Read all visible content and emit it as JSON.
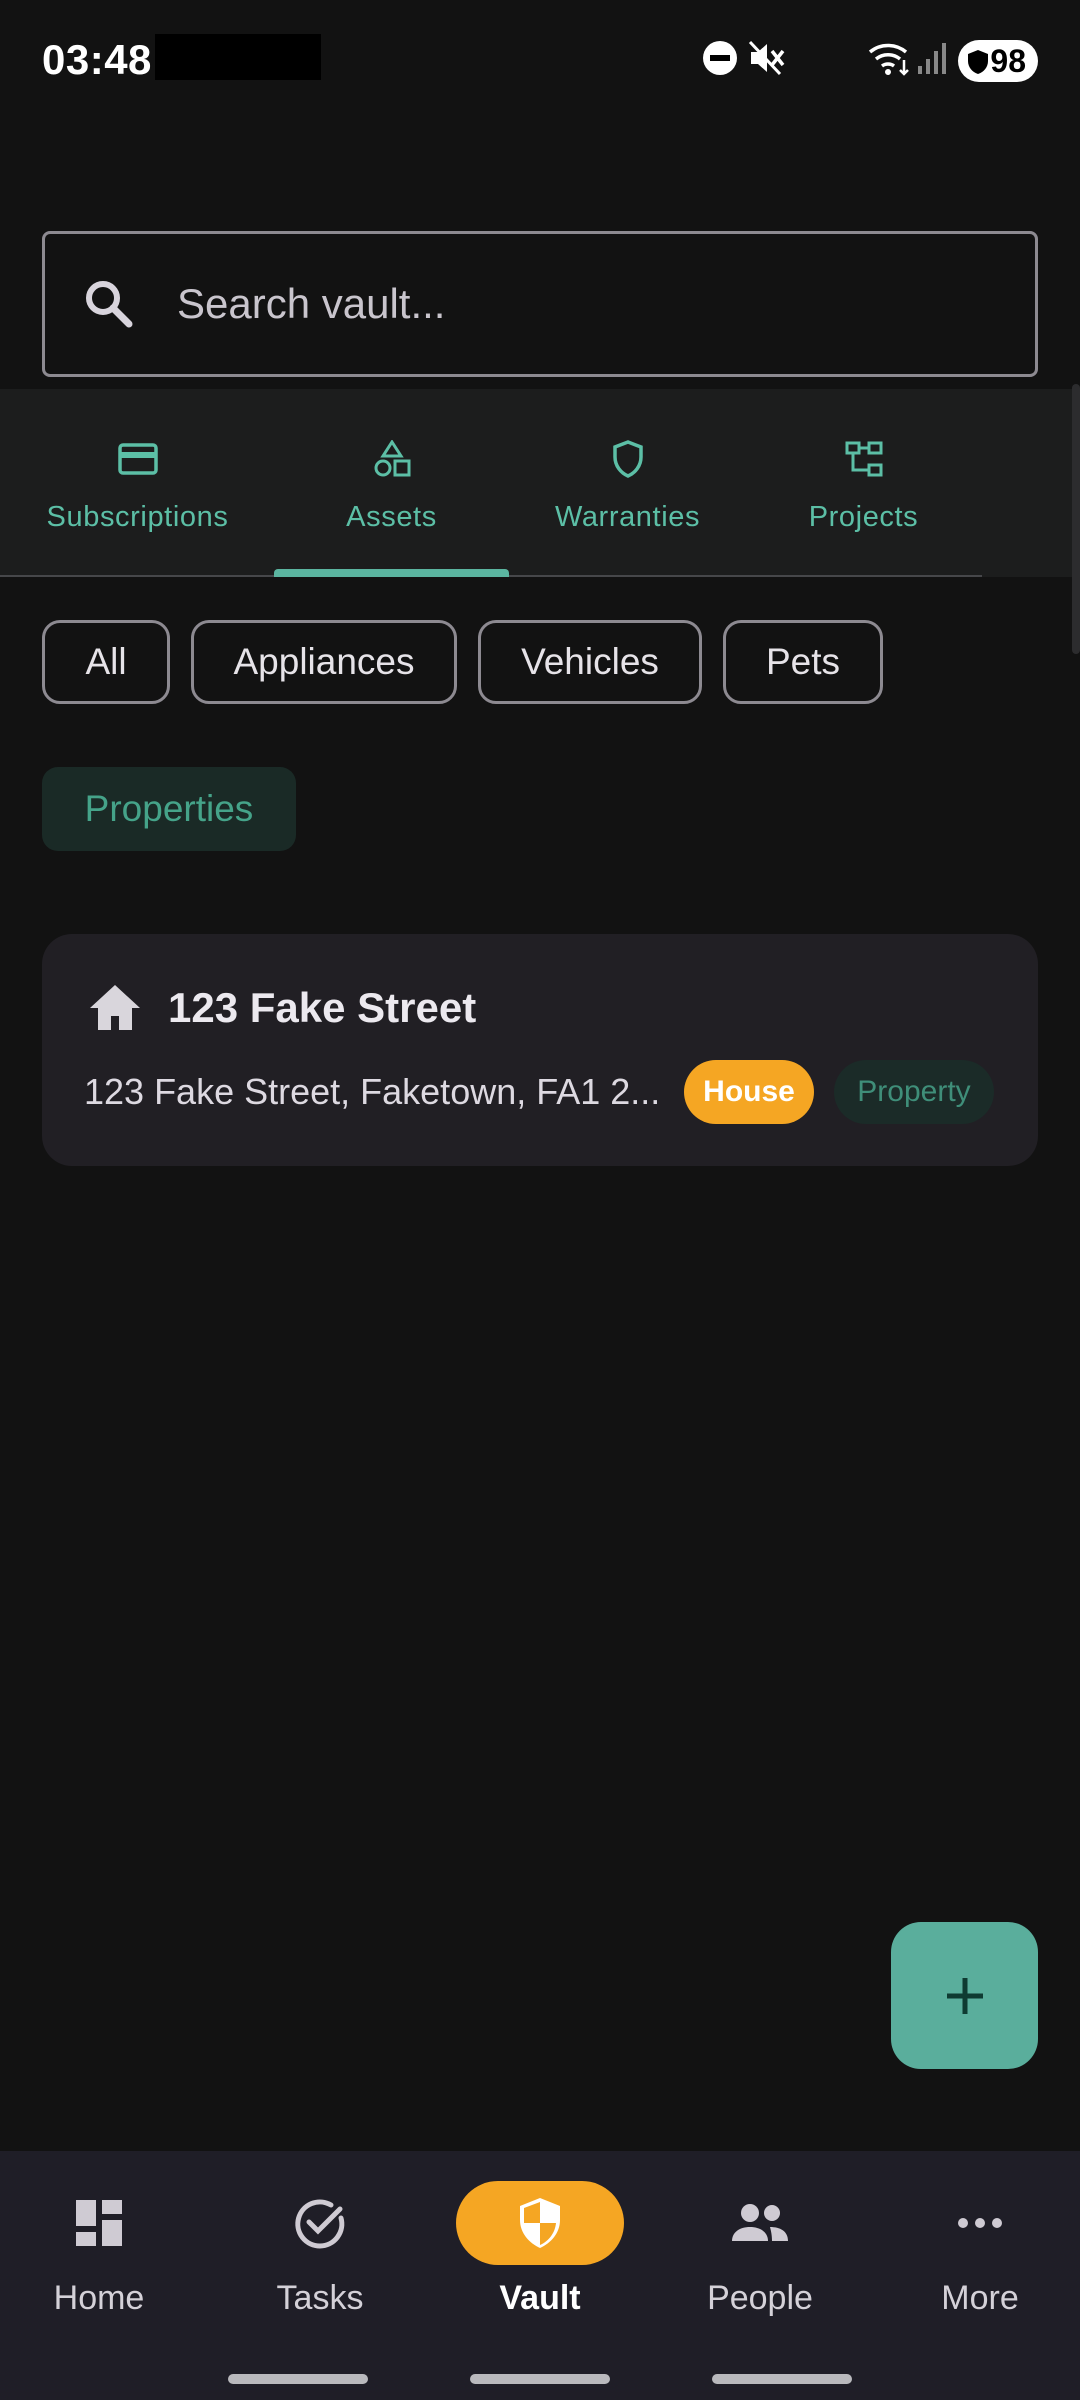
{
  "status_bar": {
    "time": "03:48",
    "battery": "98",
    "icons": [
      "do-not-disturb-icon",
      "mute-icon",
      "wifi-icon",
      "signal-icon",
      "battery-icon"
    ]
  },
  "search": {
    "placeholder": "Search vault...",
    "icon": "search-icon"
  },
  "tabs": [
    {
      "label": "Subscriptions",
      "icon": "credit-card-icon"
    },
    {
      "label": "Assets",
      "icon": "shapes-icon",
      "active": true
    },
    {
      "label": "Warranties",
      "icon": "shield-icon"
    },
    {
      "label": "Projects",
      "icon": "project-tree-icon"
    }
  ],
  "filters": {
    "chips": [
      "All",
      "Appliances",
      "Vehicles",
      "Pets"
    ],
    "selected": "Properties"
  },
  "card": {
    "title": "123 Fake Street",
    "address": "123 Fake Street, Faketown, FA1 2...",
    "badge_type": "House",
    "badge_category": "Property",
    "icon": "home-icon"
  },
  "fab": {
    "icon": "plus-icon"
  },
  "bottom_nav": [
    {
      "label": "Home",
      "icon": "dashboard-icon"
    },
    {
      "label": "Tasks",
      "icon": "check-circle-icon"
    },
    {
      "label": "Vault",
      "icon": "shield-half-icon",
      "active": true
    },
    {
      "label": "People",
      "icon": "people-icon"
    },
    {
      "label": "More",
      "icon": "more-horizontal-icon"
    }
  ],
  "colors": {
    "background": "#121212",
    "accent_teal": "#5cbfa6",
    "accent_orange": "#f5a623",
    "card": "#211f24",
    "nav_bar": "#1f1e27"
  }
}
